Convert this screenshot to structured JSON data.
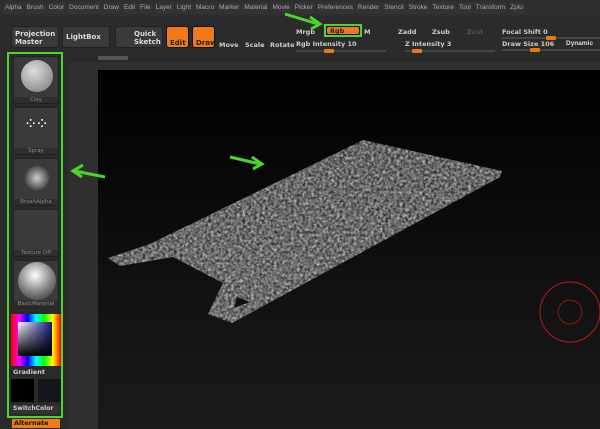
{
  "menubar": [
    "Alpha",
    "Brush",
    "Color",
    "Document",
    "Draw",
    "Edit",
    "File",
    "Layer",
    "Light",
    "Macro",
    "Marker",
    "Material",
    "Movie",
    "Picker",
    "Preferences",
    "Render",
    "Stencil",
    "Stroke",
    "Texture",
    "Tool",
    "Transform",
    "Zplu"
  ],
  "toolbar": {
    "projection_master": "Projection Master",
    "lightbox": "LightBox",
    "quick_sketch": "Quick Sketch",
    "edit": "Edit",
    "draw": "Draw",
    "move": "Move",
    "scale": "Scale",
    "rotate": "Rotate",
    "mrgb": "Mrgb",
    "rgb": "Rgb",
    "m": "M",
    "zadd": "Zadd",
    "zsub": "Zsub",
    "zcut": "Zcut",
    "rgb_intensity_label": "Rgb Intensity",
    "rgb_intensity": "10",
    "z_intensity_label": "Z Intensity",
    "z_intensity": "3",
    "focal_shift_label": "Focal Shift",
    "focal_shift": "0",
    "draw_size_label": "Draw Size",
    "draw_size": "106",
    "dynamic": "Dynamic"
  },
  "sliders": {
    "rgb_intensity_pct": 10,
    "z_intensity_pct": 3,
    "focal_shift_pct": 50,
    "draw_size_pct": 10
  },
  "leftpanel": {
    "brush": "Clay",
    "stroke": "Spray",
    "alpha": "BrushAlpha",
    "texture": "Texture Off",
    "material": "BasicMaterial",
    "gradient": "Gradient",
    "switch_color": "SwitchColor",
    "alternate": "Alternate"
  },
  "colors": {
    "accent": "#ef7a17",
    "highlight": "#4cd62a",
    "cursor": "#c0161b"
  }
}
